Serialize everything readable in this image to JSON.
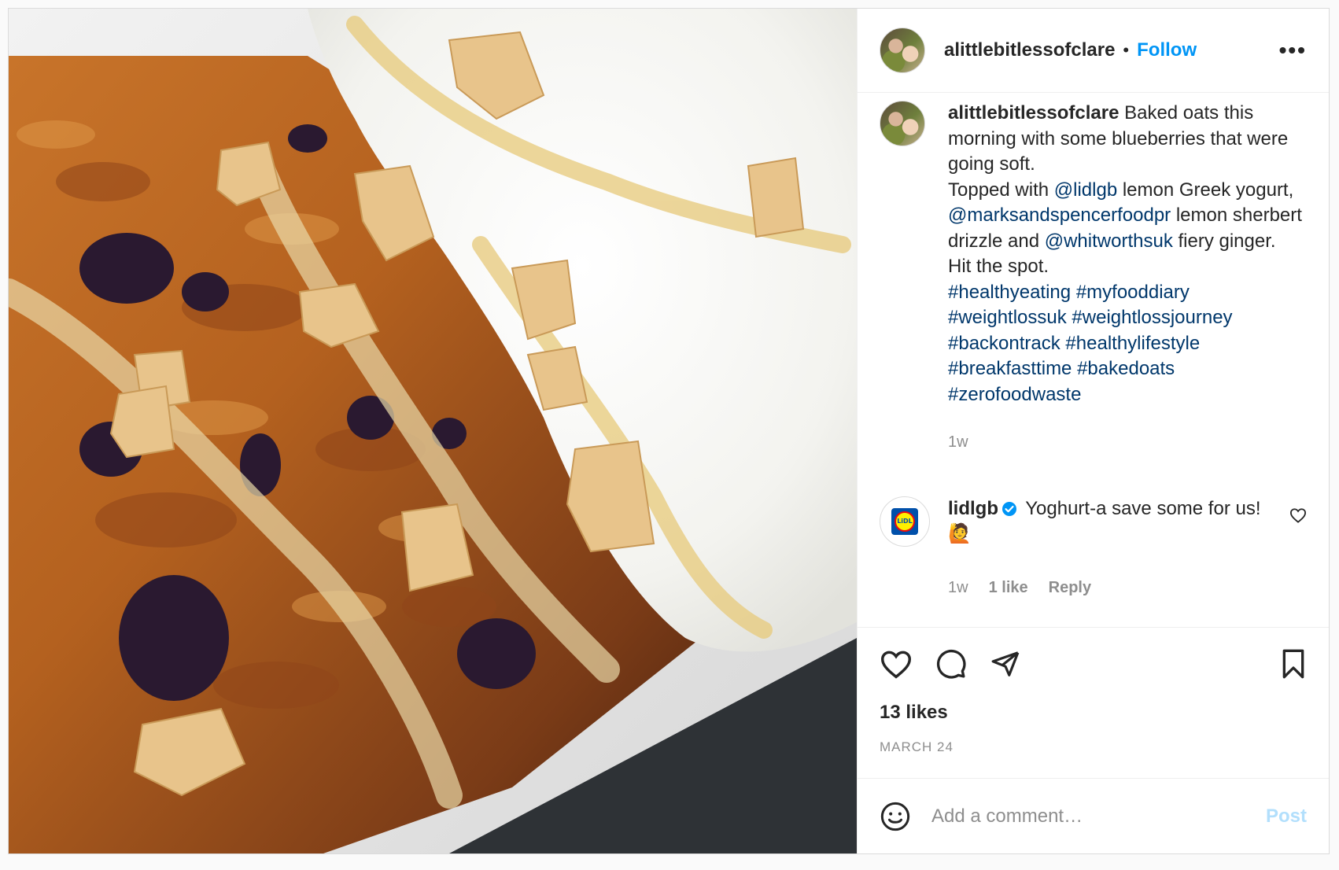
{
  "header": {
    "username": "alittlebitlessofclare",
    "separator": "•",
    "follow_label": "Follow",
    "more_label": "•••"
  },
  "caption": {
    "username": "alittlebitlessofclare",
    "segments": [
      {
        "text": " Baked oats this morning with some blueberries that were going soft.",
        "type": "text"
      },
      {
        "text": "Topped with ",
        "type": "text"
      },
      {
        "text": "@lidlgb",
        "type": "mention"
      },
      {
        "text": " lemon Greek yogurt, ",
        "type": "text"
      },
      {
        "text": "@marksandspencerfoodpr",
        "type": "mention"
      },
      {
        "text": " lemon sherbert drizzle and ",
        "type": "text"
      },
      {
        "text": "@whitworthsuk",
        "type": "mention"
      },
      {
        "text": " fiery ginger.",
        "type": "text"
      },
      {
        "text": "Hit the spot.",
        "type": "text"
      },
      {
        "text": "#healthyeating",
        "type": "tag"
      },
      {
        "text": "#myfooddiary",
        "type": "tag"
      },
      {
        "text": "#weightlossuk",
        "type": "tag"
      },
      {
        "text": "#weightlossjourney",
        "type": "tag"
      },
      {
        "text": "#backontrack",
        "type": "tag"
      },
      {
        "text": "#healthylifestyle",
        "type": "tag"
      },
      {
        "text": "#breakfasttime",
        "type": "tag"
      },
      {
        "text": "#bakedoats",
        "type": "tag"
      },
      {
        "text": "#zerofoodwaste",
        "type": "tag"
      }
    ],
    "time": "1w"
  },
  "comment": {
    "username": "lidlgb",
    "text": "Yoghurt-a save some for us! 🙋",
    "time": "1w",
    "likes": "1 like",
    "reply_label": "Reply",
    "avatar_logo_text": "LiDL"
  },
  "actions": {
    "likes": "13 likes",
    "date": "MARCH 24"
  },
  "add_comment": {
    "placeholder": "Add a comment…",
    "post_label": "Post"
  },
  "colors": {
    "link": "#00376b",
    "follow": "#0095f6",
    "muted": "#8e8e8e",
    "post_disabled": "#b2dffc"
  }
}
